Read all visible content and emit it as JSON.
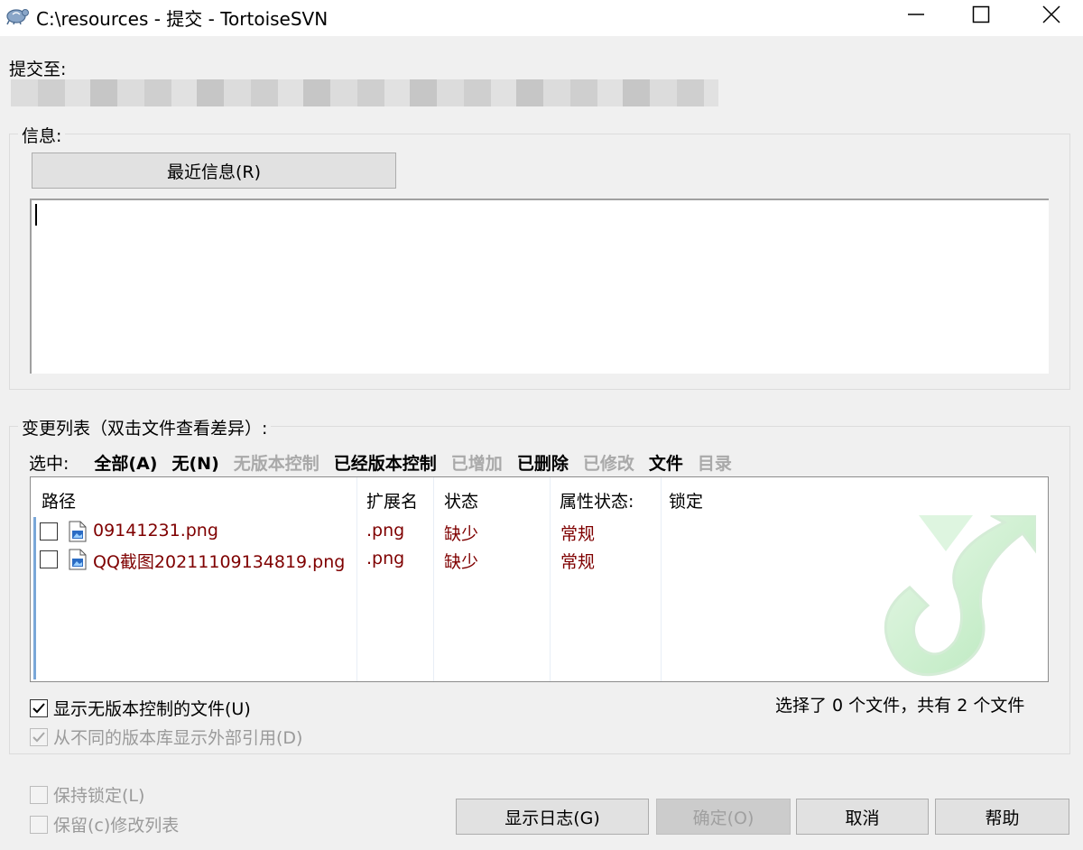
{
  "window": {
    "title": "C:\\resources - 提交 - TortoiseSVN"
  },
  "commit_to_label": "提交至:",
  "message_group": {
    "title": "信息:",
    "recent_button": "最近信息(R)",
    "message_text": ""
  },
  "changes_group": {
    "title": "变更列表（双击文件查看差异）:",
    "select_label": "选中:",
    "filters": [
      {
        "label": "全部(A)",
        "enabled": true
      },
      {
        "label": "无(N)",
        "enabled": true
      },
      {
        "label": "无版本控制",
        "enabled": false
      },
      {
        "label": "已经版本控制",
        "enabled": true
      },
      {
        "label": "已增加",
        "enabled": false
      },
      {
        "label": "已删除",
        "enabled": true
      },
      {
        "label": "已修改",
        "enabled": false
      },
      {
        "label": "文件",
        "enabled": true
      },
      {
        "label": "目录",
        "enabled": false
      }
    ],
    "columns": {
      "path": "路径",
      "ext": "扩展名",
      "status": "状态",
      "prop_status": "属性状态:",
      "lock": "锁定"
    },
    "rows": [
      {
        "path": "09141231.png",
        "ext": ".png",
        "status": "缺少",
        "prop_status": "常规",
        "checked": false
      },
      {
        "path": "QQ截图20211109134819.png",
        "ext": ".png",
        "status": "缺少",
        "prop_status": "常规",
        "checked": false
      }
    ],
    "show_unversioned": {
      "label": "显示无版本控制的文件(U)",
      "checked": true
    },
    "show_externals": {
      "label": "从不同的版本库显示外部引用(D)",
      "checked": true,
      "enabled": false
    },
    "selection_summary": "选择了 0 个文件，共有 2 个文件"
  },
  "bottom": {
    "keep_locks": {
      "label": "保持锁定(L)",
      "checked": false
    },
    "keep_changelist": {
      "label": "保留(c)修改列表",
      "checked": false
    },
    "buttons": {
      "show_log": "显示日志(G)",
      "ok": "确定(O)",
      "cancel": "取消",
      "help": "帮助"
    }
  },
  "colors": {
    "missing_file_text": "#7f0000",
    "disabled_text": "#a0a0a0",
    "background": "#f0f0f0"
  }
}
